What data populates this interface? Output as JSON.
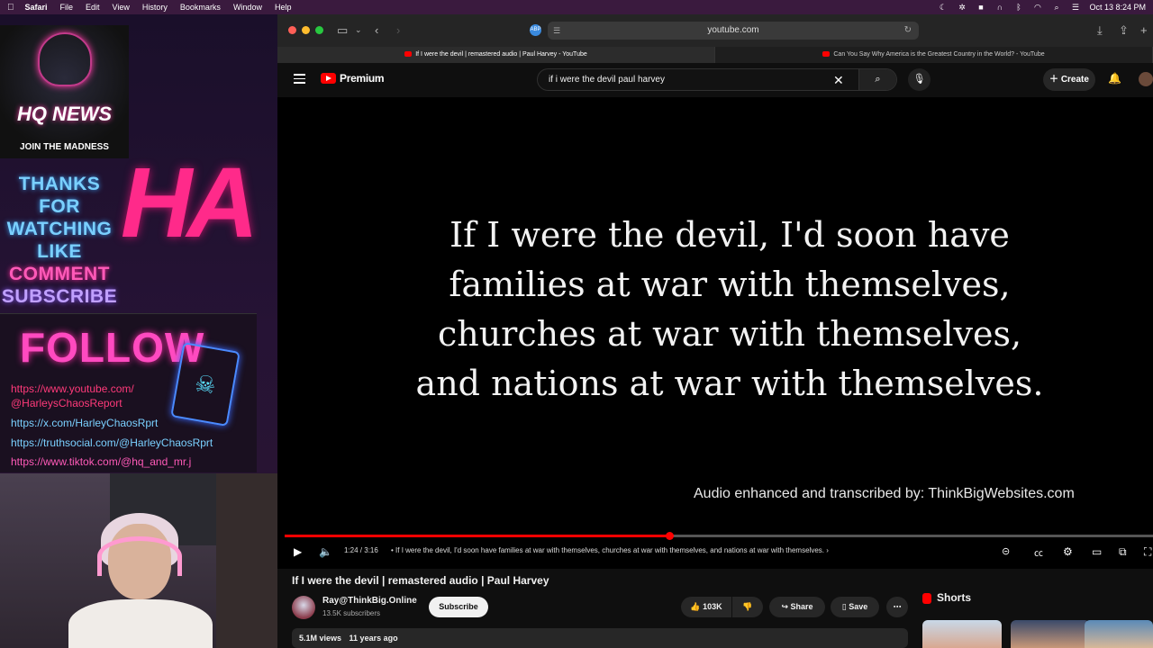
{
  "menubar": {
    "app": "Safari",
    "items": [
      "File",
      "Edit",
      "View",
      "History",
      "Bookmarks",
      "Window",
      "Help"
    ],
    "clock": "Oct 13  8:24 PM"
  },
  "overlay": {
    "logo_title": "HQ NEWS",
    "logo_tag": "JOIN THE MADNESS",
    "thanks_lines": [
      "THANKS",
      "FOR",
      "WATCHING",
      "LIKE",
      "COMMENT",
      "SUBSCRIBE"
    ],
    "ha_text": "HA",
    "follow": "FOLLOW",
    "links": [
      "https://www.youtube.com/",
      "@HarleysChaosReport",
      "https://x.com/HarleyChaosRprt",
      "https://truthsocial.com/@HarleyChaosRprt",
      "https://www.tiktok.com/@hq_and_mr.j"
    ]
  },
  "browser": {
    "address": "youtube.com",
    "tabs": [
      {
        "label": "If I were the devil | remastered audio | Paul Harvey - YouTube"
      },
      {
        "label": "Can You Say Why America is the Greatest Country in the World? - YouTube"
      }
    ]
  },
  "youtube": {
    "logo_word": "Premium",
    "search_value": "if i were the devil paul harvey",
    "create_label": "Create",
    "video": {
      "caption_lines": [
        "If I were the devil, I'd soon have",
        "families at war with themselves,",
        "churches at war with themselves,",
        "and nations at war with themselves."
      ],
      "credit": "Audio enhanced and transcribed by: ThinkBigWebsites.com",
      "time": "1:24 / 3:16",
      "chapter": "•  If I were the devil, I'd soon have families at war with themselves, churches at war with themselves, and nations at war with themselves.",
      "progress_fraction": 0.443
    },
    "title": "If I were the devil | remastered audio | Paul Harvey",
    "channel": "Ray@ThinkBig.Online",
    "subscribers": "13.5K subscribers",
    "subscribe_label": "Subscribe",
    "likes": "103K",
    "share_label": "Share",
    "save_label": "Save",
    "views": "5.1M views",
    "age": "11 years ago",
    "shorts_label": "Shorts"
  },
  "colors": {
    "accent": "#ff0000",
    "neon_pink": "#ff2a8a",
    "neon_blue": "#7ad0ff"
  }
}
